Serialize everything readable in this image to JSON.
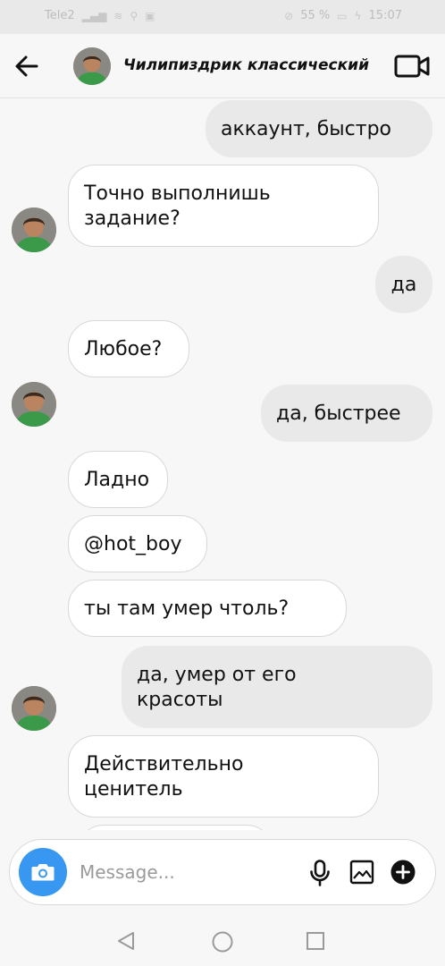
{
  "status_bar": {
    "carrier": "Tele2",
    "battery": "55 %",
    "time": "15:07"
  },
  "header": {
    "title": "Чилипиздрик классический",
    "back_icon": "arrow-left-icon",
    "video_icon": "video-camera-icon"
  },
  "messages": [
    {
      "dir": "out",
      "lines": [
        "аккаунт, быстро"
      ]
    },
    {
      "dir": "in",
      "lines": [
        "Точно выполнишь",
        "задание?"
      ],
      "avatar": true
    },
    {
      "dir": "out",
      "lines": [
        "да"
      ]
    },
    {
      "dir": "in",
      "lines": [
        "Любое?"
      ],
      "avatar": true
    },
    {
      "dir": "out",
      "lines": [
        "да, быстрее"
      ]
    },
    {
      "dir": "in",
      "lines": [
        "Ладно"
      ]
    },
    {
      "dir": "in",
      "lines": [
        "@hot_boy"
      ]
    },
    {
      "dir": "in",
      "lines": [
        "ты там умер чтоль?"
      ],
      "avatar": true
    },
    {
      "dir": "out",
      "lines": [
        "да, умер от его",
        "красоты"
      ]
    },
    {
      "dir": "in",
      "lines": [
        "Действительно",
        "ценитель"
      ]
    }
  ],
  "composer": {
    "placeholder": "Message...",
    "value": "",
    "camera_icon": "camera-icon",
    "mic_icon": "microphone-icon",
    "gallery_icon": "gallery-icon",
    "plus_icon": "plus-circle-icon"
  },
  "colors": {
    "accent": "#3897f0",
    "outgoing_bubble": "#e9e9e9",
    "incoming_bubble": "#ffffff",
    "chat_background": "#f7f7f7"
  }
}
